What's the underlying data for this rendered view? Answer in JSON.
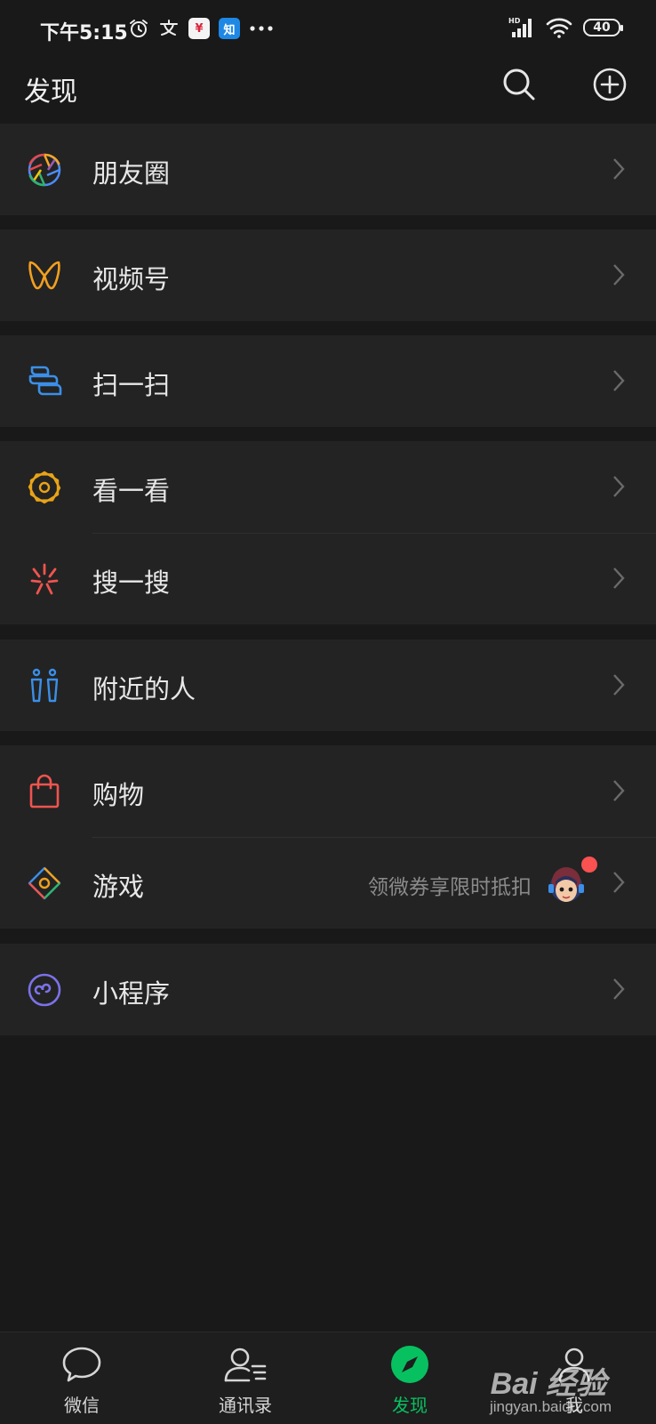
{
  "status_bar": {
    "time": "下午5:15",
    "icons": [
      "alarm-icon",
      "alipay-icon",
      "yen-app-icon",
      "zhihu-icon",
      "more-dots-icon"
    ],
    "zhihu_label": "知",
    "yen_label": "¥",
    "network_label": "HD",
    "battery": "40"
  },
  "header": {
    "title": "发现"
  },
  "menu": {
    "moments": "朋友圈",
    "channels": "视频号",
    "scan": "扫一扫",
    "top_stories": "看一看",
    "search": "搜一搜",
    "nearby": "附近的人",
    "shopping": "购物",
    "games": "游戏",
    "games_hint": "领微券享限时抵扣",
    "mini_programs": "小程序"
  },
  "tabs": {
    "chats": "微信",
    "contacts": "通讯录",
    "discover": "发现",
    "me": "我"
  },
  "watermark": {
    "logo": "Bai 经验",
    "url": "jingyan.baidu.com"
  },
  "colors": {
    "accent": "#07c160",
    "badge": "#fa5151",
    "background": "#191919",
    "cell": "#232323"
  }
}
